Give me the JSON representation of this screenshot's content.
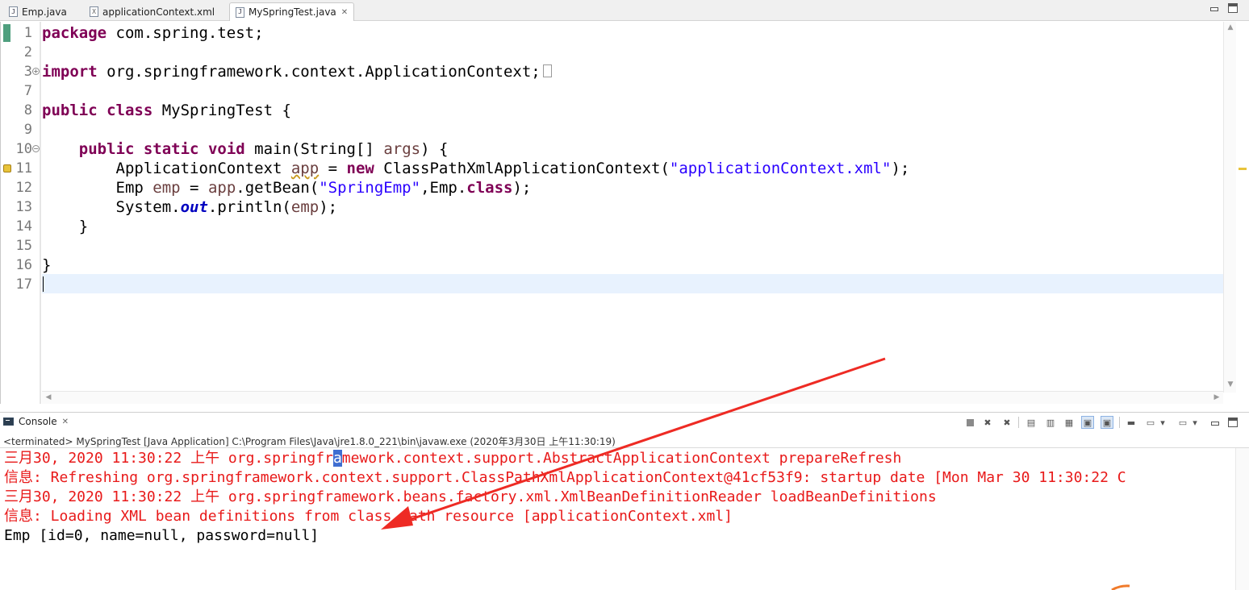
{
  "editor_tabs": [
    {
      "label": "Emp.java",
      "icon": "java-file-icon",
      "icon_glyph": "J",
      "active": false
    },
    {
      "label": "applicationContext.xml",
      "icon": "xml-file-icon",
      "icon_glyph": "X",
      "active": false
    },
    {
      "label": "MySpringTest.java",
      "icon": "java-file-icon",
      "icon_glyph": "J",
      "active": true
    }
  ],
  "close_glyph": "✕",
  "code_lines": [
    {
      "num": "1",
      "html": "<span class=\"kw\">package</span> com.spring.test;"
    },
    {
      "num": "2",
      "html": ""
    },
    {
      "num": "3",
      "fold": "plus",
      "html": "<span class=\"kw\">import</span> org.springframework.context.ApplicationContext;<span class=\"collapsed-box\"></span>"
    },
    {
      "num": "7",
      "html": ""
    },
    {
      "num": "8",
      "html": "<span class=\"kw\">public</span> <span class=\"kw\">class</span> MySpringTest {"
    },
    {
      "num": "9",
      "html": ""
    },
    {
      "num": "10",
      "fold": "minus",
      "html": "    <span class=\"kw\">public</span> <span class=\"kw\">static</span> <span class=\"kw\">void</span> main(String[] <span class=\"var\">args</span>) {"
    },
    {
      "num": "11",
      "warn": true,
      "html": "        ApplicationContext <span class=\"var warnvar\">app</span> = <span class=\"kw\">new</span> ClassPathXmlApplicationContext(<span class=\"str\">\"applicationContext.xml\"</span>);"
    },
    {
      "num": "12",
      "html": "        Emp <span class=\"var\">emp</span> = <span class=\"var\">app</span>.getBean(<span class=\"str\">\"SpringEmp\"</span>,Emp.<span class=\"kw\">class</span>);"
    },
    {
      "num": "13",
      "html": "        System.<span class=\"fld\">out</span>.println(<span class=\"var\">emp</span>);"
    },
    {
      "num": "14",
      "html": "    }"
    },
    {
      "num": "15",
      "html": ""
    },
    {
      "num": "16",
      "html": "}"
    },
    {
      "num": "17",
      "html": ""
    }
  ],
  "console": {
    "tab_label": "Console",
    "status": "<terminated> MySpringTest [Java Application] C:\\Program Files\\Java\\jre1.8.0_221\\bin\\javaw.exe (2020年3月30日 上午11:30:19)",
    "lines": [
      {
        "type": "err",
        "pre": "三月30, 2020 11:30:22 上午 org.springfr",
        "hl": "a",
        "post": "mework.context.support.AbstractApplicationContext prepareRefresh"
      },
      {
        "type": "err",
        "pre": "信息: Refreshing org.springframework.context.support.ClassPathXmlApplicationContext@41cf53f9: startup date [Mon Mar 30 11:30:22 C",
        "hl": "",
        "post": ""
      },
      {
        "type": "err",
        "pre": "三月30, 2020 11:30:22 上午 org.springframework.beans.factory.xml.XmlBeanDefinitionReader loadBeanDefinitions",
        "hl": "",
        "post": ""
      },
      {
        "type": "err",
        "pre": "信息: Loading XML bean definitions from class path resource [applicationContext.xml]",
        "hl": "",
        "post": ""
      },
      {
        "type": "out",
        "pre": "Emp [id=0, name=null, password=null]",
        "hl": "",
        "post": ""
      }
    ]
  },
  "toolbar_icons": [
    "terminate-icon",
    "remove-launch-icon",
    "remove-all-terminated-icon",
    "clear-console-icon",
    "scroll-lock-icon",
    "word-wrap-icon",
    "show-on-stdout-icon",
    "show-on-stderr-icon",
    "pin-console-icon",
    "display-selected-console-icon",
    "open-console-icon"
  ],
  "colors": {
    "keyword": "#7f0055",
    "string": "#2a00ff",
    "stderr": "#e81919",
    "annotation_arrow": "#ee2b24",
    "current_line": "#e8f2fe"
  }
}
